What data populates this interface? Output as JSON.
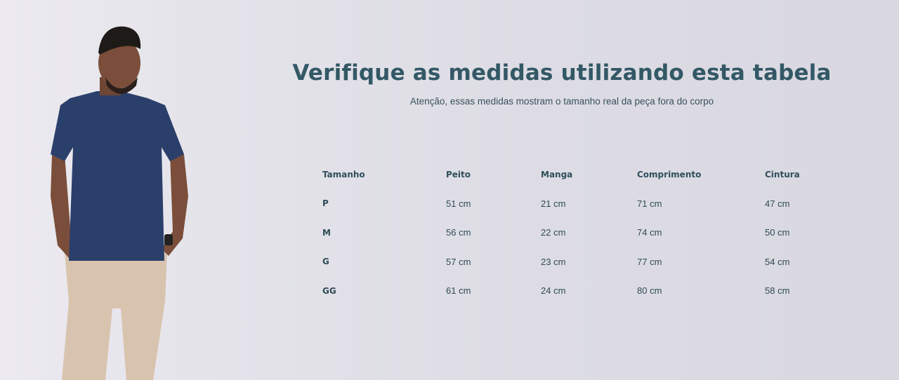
{
  "header": {
    "title": "Verifique as medidas utilizando esta tabela",
    "subtitle": "Atenção, essas medidas mostram o tamanho real da peça fora do corpo"
  },
  "colors": {
    "title": "#335866",
    "shirt": "#2b3f6b",
    "pants": "#d8c3ae"
  },
  "table": {
    "headers": [
      "Tamanho",
      "Peito",
      "Manga",
      "Comprimento",
      "Cintura"
    ],
    "rows": [
      [
        "P",
        "51 cm",
        "21 cm",
        "71 cm",
        "47 cm"
      ],
      [
        "M",
        "56 cm",
        "22 cm",
        "74 cm",
        "50 cm"
      ],
      [
        "G",
        "57 cm",
        "23 cm",
        "77 cm",
        "54 cm"
      ],
      [
        "GG",
        "61 cm",
        "24 cm",
        "80 cm",
        "58 cm"
      ]
    ]
  }
}
